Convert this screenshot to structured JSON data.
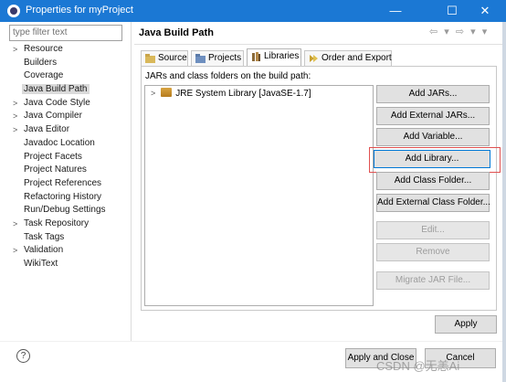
{
  "window": {
    "title": "Properties for myProject",
    "minimize": "—",
    "maximize": "☐",
    "close": "✕"
  },
  "filter": {
    "placeholder": "type filter text"
  },
  "tree": {
    "items": [
      {
        "label": "Resource",
        "expandable": true
      },
      {
        "label": "Builders",
        "expandable": false
      },
      {
        "label": "Coverage",
        "expandable": false
      },
      {
        "label": "Java Build Path",
        "expandable": false,
        "selected": true
      },
      {
        "label": "Java Code Style",
        "expandable": true
      },
      {
        "label": "Java Compiler",
        "expandable": true
      },
      {
        "label": "Java Editor",
        "expandable": true
      },
      {
        "label": "Javadoc Location",
        "expandable": false
      },
      {
        "label": "Project Facets",
        "expandable": false
      },
      {
        "label": "Project Natures",
        "expandable": false
      },
      {
        "label": "Project References",
        "expandable": false
      },
      {
        "label": "Refactoring History",
        "expandable": false
      },
      {
        "label": "Run/Debug Settings",
        "expandable": false
      },
      {
        "label": "Task Repository",
        "expandable": true
      },
      {
        "label": "Task Tags",
        "expandable": false
      },
      {
        "label": "Validation",
        "expandable": true
      },
      {
        "label": "WikiText",
        "expandable": false
      }
    ]
  },
  "page": {
    "title": "Java Build Path",
    "nav": "⇦ ▾ ⇨ ▾ ▾"
  },
  "tabs": [
    {
      "label": "Source",
      "icon": "source-folder-icon"
    },
    {
      "label": "Projects",
      "icon": "projects-icon"
    },
    {
      "label": "Libraries",
      "icon": "libraries-icon",
      "active": true
    },
    {
      "label": "Order and Export",
      "icon": "order-export-icon"
    }
  ],
  "libraries": {
    "label": "JARs and class folders on the build path:",
    "entries": [
      {
        "label": "JRE System Library [JavaSE-1.7]"
      }
    ]
  },
  "buttons": {
    "add_jars": "Add JARs...",
    "add_external_jars": "Add External JARs...",
    "add_variable": "Add Variable...",
    "add_library": "Add Library...",
    "add_class_folder": "Add Class Folder...",
    "add_external_class_folder": "Add External Class Folder...",
    "edit": "Edit...",
    "remove": "Remove",
    "migrate_jar": "Migrate JAR File...",
    "apply": "Apply",
    "apply_and_close": "Apply and Close",
    "cancel": "Cancel"
  },
  "help": "?",
  "watermark": "CSDN @无恙Ai",
  "colors": {
    "titlebar": "#1b78d4",
    "highlight": "#e05050",
    "focus": "#0078d7"
  }
}
